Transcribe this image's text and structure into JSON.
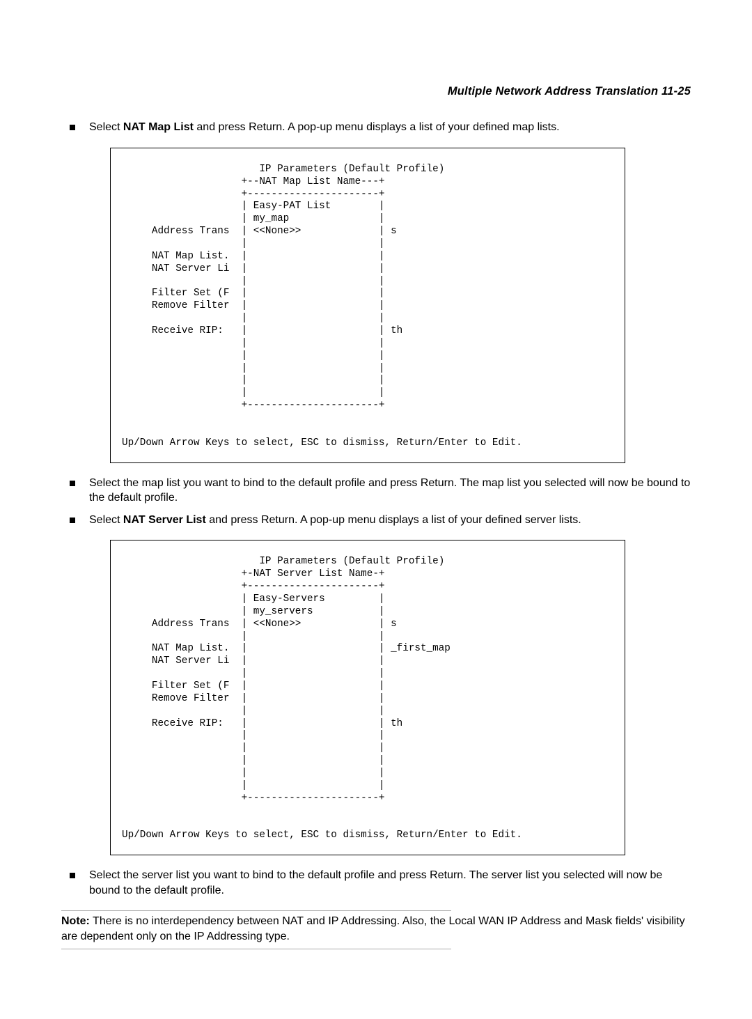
{
  "header": {
    "title": "Multiple Network Address Translation   11-25"
  },
  "bullets1": {
    "b1_pre": "Select ",
    "b1_bold": "NAT Map List",
    "b1_post": " and press Return. A pop-up menu displays a list of your defined map lists."
  },
  "terminal1": "                       IP Parameters (Default Profile)\n                    +--NAT Map List Name---+\n                    +----------------------+\n                    | Easy-PAT List        |\n                    | my_map               |\n     Address Trans  | <<None>>             | s\n                    |                      |\n     NAT Map List.  |                      |\n     NAT Server Li  |                      |\n                    |                      |\n     Filter Set (F  |                      |\n     Remove Filter  |                      |\n                    |                      |\n     Receive RIP:   |                      | th\n                    |                      |\n                    |                      |\n                    |                      |\n                    |                      |\n                    |                      |\n                    +----------------------+\n\n\nUp/Down Arrow Keys to select, ESC to dismiss, Return/Enter to Edit.",
  "bullets2": {
    "b1": "Select the map list you want to bind to the default profile and press Return. The map list you selected will now be bound to the default profile.",
    "b2_pre": "Select ",
    "b2_bold": "NAT Server List",
    "b2_post": " and press Return. A pop-up menu displays a list of your defined server lists."
  },
  "terminal2": "                       IP Parameters (Default Profile)\n                    +-NAT Server List Name-+\n                    +----------------------+\n                    | Easy-Servers         |\n                    | my_servers           |\n     Address Trans  | <<None>>             | s\n                    |                      |\n     NAT Map List.  |                      | _first_map\n     NAT Server Li  |                      |\n                    |                      |\n     Filter Set (F  |                      |\n     Remove Filter  |                      |\n                    |                      |\n     Receive RIP:   |                      | th\n                    |                      |\n                    |                      |\n                    |                      |\n                    |                      |\n                    |                      |\n                    +----------------------+\n\n\nUp/Down Arrow Keys to select, ESC to dismiss, Return/Enter to Edit.",
  "bullets3": {
    "b1": "Select the server list you want to bind to the default profile and press Return. The server list you selected will now be bound to the default profile."
  },
  "note": {
    "label": "Note:",
    "text": " There is no interdependency between NAT and IP Addressing. Also, the Local WAN IP Address and Mask fields' visibility are dependent only on the IP Addressing type."
  }
}
